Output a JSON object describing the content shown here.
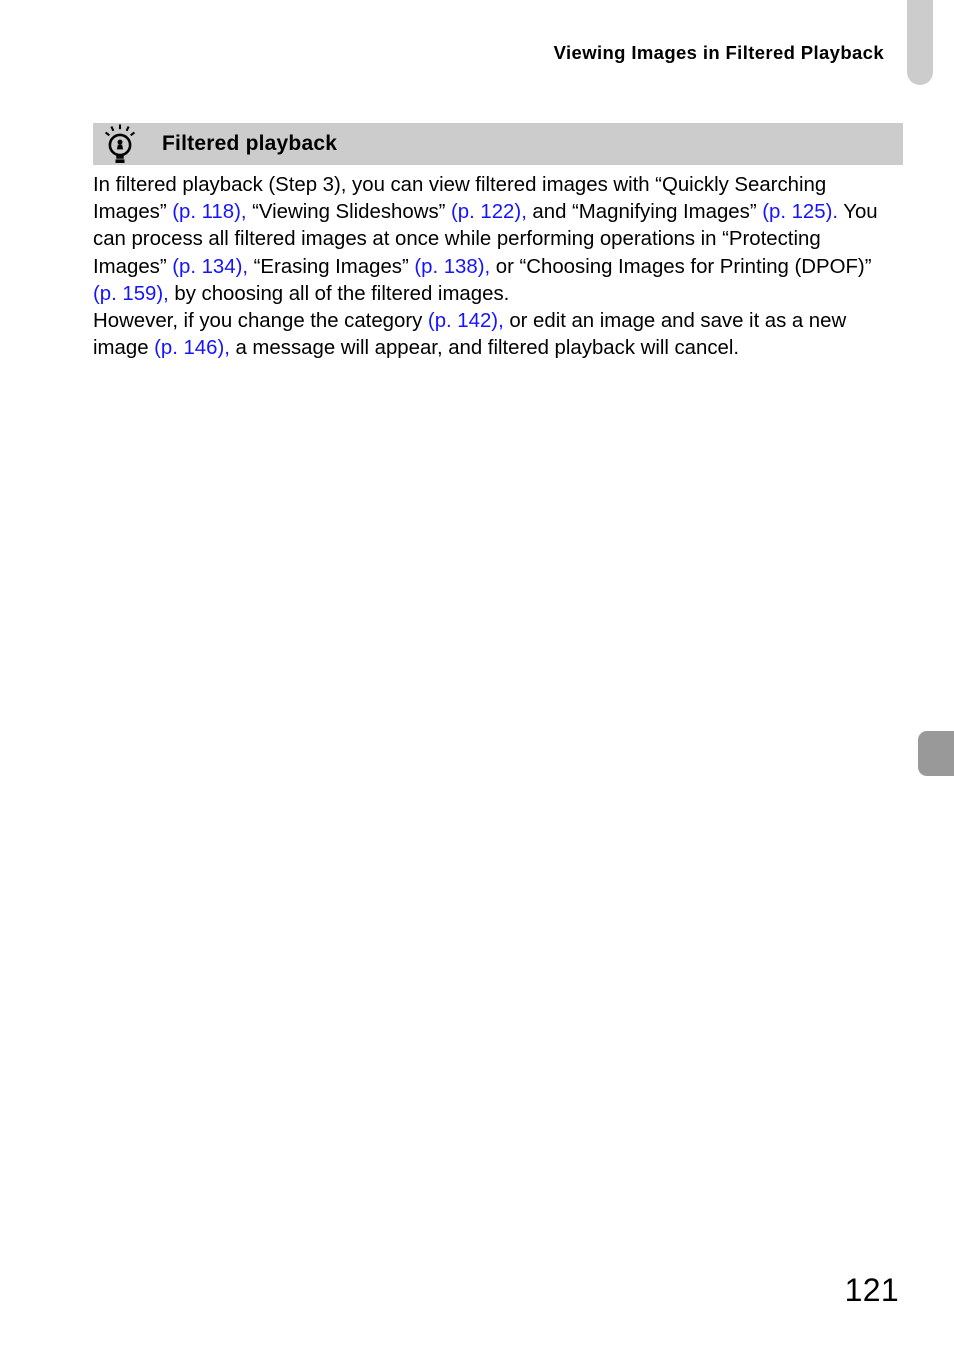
{
  "page": {
    "running_header": "Viewing Images in Filtered Playback",
    "folio": "121"
  },
  "tip_box": {
    "icon": "lightbulb-tip-icon",
    "title": "Filtered playback",
    "bar_color": "#cccccc",
    "paragraphs": [
      {
        "id": "para1",
        "runs": [
          {
            "text": "In filtered playback (Step 3), you can view filtered images with “Quickly Searching Images” ",
            "style": "plain"
          },
          {
            "text": "(p. 118),",
            "style": "ref"
          },
          {
            "text": " “Viewing Slideshows” ",
            "style": "plain"
          },
          {
            "text": "(p. 122),",
            "style": "ref"
          },
          {
            "text": " and “Magnifying Images” ",
            "style": "plain"
          },
          {
            "text": "(p. 125).",
            "style": "ref"
          },
          {
            "text": " You can process all filtered images at once while performing operations in “Protecting Images” ",
            "style": "plain"
          },
          {
            "text": "(p. 134),",
            "style": "ref"
          },
          {
            "text": " “Erasing Images” ",
            "style": "plain"
          },
          {
            "text": "(p. 138),",
            "style": "ref"
          },
          {
            "text": " or “Choosing Images for Printing (DPOF)” ",
            "style": "plain"
          },
          {
            "text": "(p. 159),",
            "style": "ref"
          },
          {
            "text": " by choosing all of the filtered images.",
            "style": "plain"
          }
        ]
      },
      {
        "id": "para2",
        "runs": [
          {
            "text": "However, if you change the category ",
            "style": "plain"
          },
          {
            "text": "(p. 142),",
            "style": "ref"
          },
          {
            "text": " or edit an image and save it as a new image ",
            "style": "plain"
          },
          {
            "text": "(p. 146),",
            "style": "ref"
          },
          {
            "text": " a message will appear, and filtered playback will cancel.",
            "style": "plain"
          }
        ]
      }
    ]
  },
  "decorations": {
    "tab_top_color": "#cccccc",
    "tab_mid_color": "#999999"
  },
  "colors": {
    "text": "#000000",
    "reference_link": "#1414ff",
    "tip_bar": "#cccccc"
  }
}
